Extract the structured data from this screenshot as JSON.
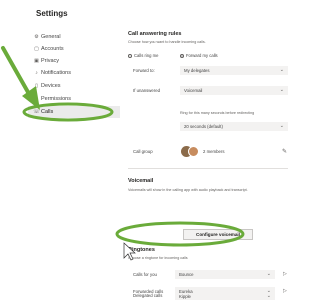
{
  "window": {
    "title": "Settings"
  },
  "sidebar": {
    "items": [
      {
        "label": "General",
        "icon": "gear-icon"
      },
      {
        "label": "Accounts",
        "icon": "accounts-icon"
      },
      {
        "label": "Privacy",
        "icon": "lock-icon"
      },
      {
        "label": "Notifications",
        "icon": "bell-icon"
      },
      {
        "label": "Devices",
        "icon": "device-icon"
      },
      {
        "label": "Permissions",
        "icon": "key-icon"
      },
      {
        "label": "Calls",
        "icon": "phone-icon",
        "selected": true
      }
    ]
  },
  "call_answering": {
    "heading": "Call answering rules",
    "description": "Choose how you want to handle incoming calls.",
    "options": [
      {
        "label": "Calls ring me",
        "selected": false
      },
      {
        "label": "Forward my calls",
        "selected": true
      }
    ],
    "forward_to_label": "Forward to:",
    "forward_to_value": "My delegates",
    "if_unanswered_label": "If unanswered",
    "if_unanswered_value": "Voicemail",
    "ring_description": "Ring for this many seconds before redirecting",
    "ring_value": "20 seconds (default)",
    "call_group_label": "Call group",
    "call_group_count": "2 members"
  },
  "voicemail": {
    "heading": "Voicemail",
    "description": "Voicemails will show in the calling app with audio playback and transcript.",
    "configure_button": "Configure voicemail"
  },
  "ringtones": {
    "heading": "Ringtones",
    "description": "Choose a ringtone for incoming calls",
    "rows": [
      {
        "label": "Calls for you",
        "value": "Bounce"
      },
      {
        "label": "Forwarded calls",
        "value": "Eureka"
      },
      {
        "label": "Delegated calls",
        "value": "Kipple"
      }
    ]
  },
  "colors": {
    "annotation": "#6aab3a",
    "selected_bg": "#ebebeb",
    "field_bg": "#f3f2f1"
  }
}
